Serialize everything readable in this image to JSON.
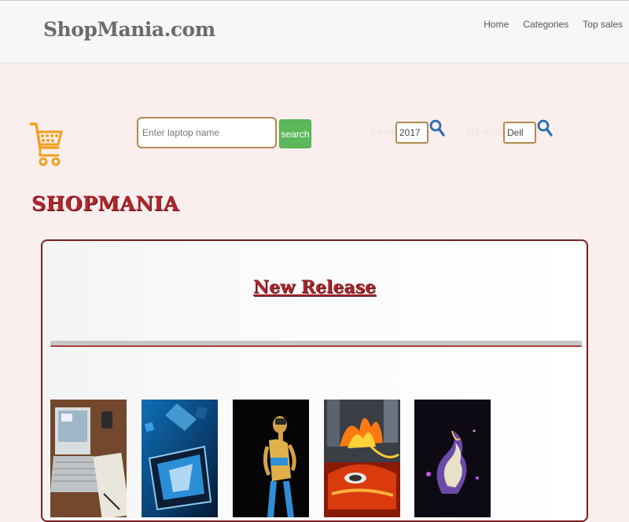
{
  "header": {
    "brand": "ShopMania.com",
    "nav": [
      "Home",
      "Categories",
      "Top sales"
    ]
  },
  "search": {
    "placeholder": "Enter laptop name",
    "button": "search"
  },
  "filters": {
    "year_label": "Year",
    "year_value": "2017",
    "brands_label": "Brands",
    "brands_value": "Dell"
  },
  "page_title": "SHOPMANIA",
  "panel": {
    "title": "New Release",
    "items": [
      {
        "image": "laptop-on-desk"
      },
      {
        "image": "blue-tech-screen"
      },
      {
        "image": "vr-headset-figure"
      },
      {
        "image": "car-in-flames"
      },
      {
        "image": "abstract-glowing-sculpture"
      }
    ]
  },
  "colors": {
    "background": "#fbeeee",
    "brand_red": "#b0272c",
    "search_green": "#5cb85c",
    "input_border": "#b08a4e",
    "cart_orange": "#f0a020",
    "icon_blue": "#2a6db0"
  }
}
